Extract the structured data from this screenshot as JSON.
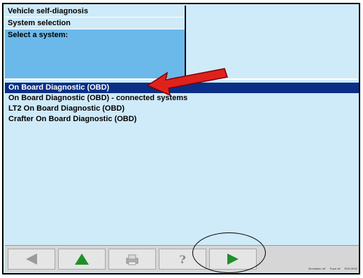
{
  "header": {
    "title": "Vehicle self-diagnosis",
    "subtitle": "System selection",
    "prompt": "Select a system:"
  },
  "list": {
    "items": [
      {
        "label": "On Board Diagnostic (OBD)",
        "selected": true
      },
      {
        "label": "On Board Diagnostic (OBD) - connected systems",
        "selected": false
      },
      {
        "label": "LT2 On Board Diagnostic (OBD)",
        "selected": false
      },
      {
        "label": "Crafter On Board Diagnostic (OBD)",
        "selected": false
      }
    ]
  },
  "toolbar": {
    "buttons": [
      {
        "icon": "back-arrow-icon"
      },
      {
        "icon": "up-arrow-icon"
      },
      {
        "icon": "print-icon"
      },
      {
        "icon": "help-icon",
        "glyph": "?"
      },
      {
        "icon": "forward-arrow-icon"
      }
    ]
  },
  "status": {
    "simulation": "Simulation off",
    "trace": "Trace off",
    "code": "EDIC3032"
  },
  "colors": {
    "background": "#cfeaf8",
    "selection": "#0b2f86",
    "prompt_bg": "#6bb9ea",
    "green": "#1f8f2a",
    "arrow_red": "#e0221d"
  }
}
